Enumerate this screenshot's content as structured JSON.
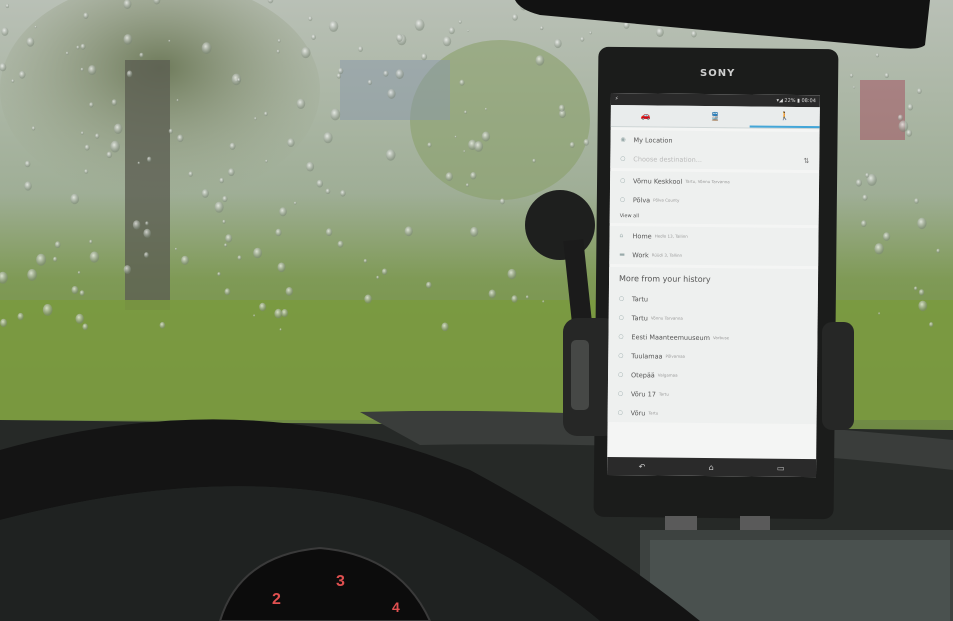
{
  "phone": {
    "brand": "SONY",
    "status_bar": {
      "time": "08:04",
      "battery": "22%"
    },
    "tabs": [
      {
        "icon": "car-icon",
        "active": false
      },
      {
        "icon": "transit-icon",
        "active": false
      },
      {
        "icon": "walk-icon",
        "active": true
      }
    ],
    "route": {
      "origin": "My Location",
      "destination_placeholder": "Choose destination..."
    },
    "suggestions": [
      {
        "label": "Võrnu Keskkool",
        "sublabel": "Tartu, Võnnu Tarvanna"
      },
      {
        "label": "Põlva",
        "sublabel": "Põlva County"
      }
    ],
    "view_all_label": "View all",
    "saved_places": [
      {
        "label": "Home",
        "sublabel": "Hedlo 13, Tallinn"
      },
      {
        "label": "Work",
        "sublabel": "Rüüdi 3, Tallinn"
      }
    ],
    "history_heading": "More from your history",
    "history": [
      {
        "label": "Tartu",
        "sublabel": ""
      },
      {
        "label": "Tartu",
        "sublabel": "Võnnu Tarvanna"
      },
      {
        "label": "Eesti Maanteemuuseum",
        "sublabel": "Varbuse"
      },
      {
        "label": "Tuulamaa",
        "sublabel": "Põlvamaa"
      },
      {
        "label": "Otepää",
        "sublabel": "Valgamaa"
      },
      {
        "label": "Võru 17",
        "sublabel": "Tartu"
      },
      {
        "label": "Võru",
        "sublabel": "Tartu"
      }
    ]
  }
}
